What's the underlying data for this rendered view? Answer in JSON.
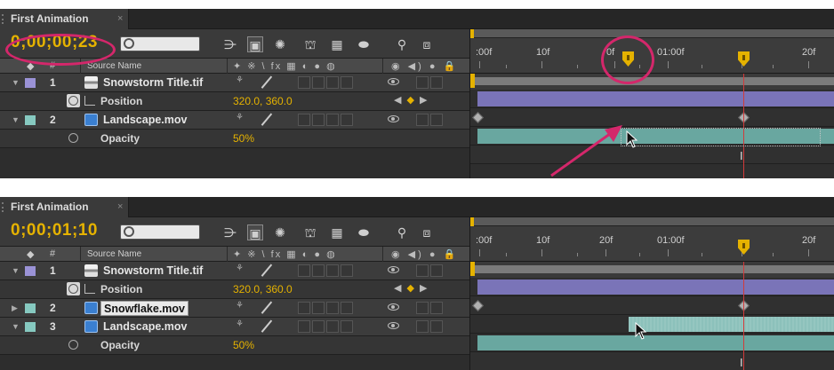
{
  "colors": {
    "timecode": "#e5b200",
    "label_purple": "#9a92d6",
    "label_teal": "#86c9c0",
    "layer_bar_purple": "#7a74b8",
    "layer_bar_teal": "#69a7a0",
    "cti": "#d23a3a",
    "annotation": "#d4276b"
  },
  "panels": [
    {
      "tab_title": "First Animation",
      "tab_close": "×",
      "timecode": "0;00;00;23",
      "columns": {
        "label_icon": "◆",
        "number_header": "#",
        "source_name_header": "Source Name",
        "switches_header": "✦ ※ \\ fx ▦ ◐ ● ◍",
        "av_header": "◉ ◀) ● 🔒"
      },
      "layers": [
        {
          "number": "1",
          "name": "Snowstorm Title.tif",
          "type": "tif",
          "label_color": "#9a92d6"
        },
        {
          "number": "2",
          "name": "Landscape.mov",
          "type": "mov",
          "label_color": "#86c9c0"
        }
      ],
      "properties": [
        {
          "name": "Position",
          "value": "320.0, 360.0"
        },
        {
          "name": "Opacity",
          "value": "50%"
        }
      ],
      "ruler_labels": [
        ":00f",
        "10f",
        "0f",
        "01:00f",
        "20f"
      ]
    },
    {
      "tab_title": "First Animation",
      "tab_close": "×",
      "timecode": "0;00;01;10",
      "columns": {
        "label_icon": "◆",
        "number_header": "#",
        "source_name_header": "Source Name",
        "switches_header": "✦ ※ \\ fx ▦ ◐ ● ◍",
        "av_header": "◉ ◀) ● 🔒"
      },
      "layers": [
        {
          "number": "1",
          "name": "Snowstorm Title.tif",
          "type": "tif",
          "label_color": "#9a92d6"
        },
        {
          "number": "2",
          "name": "Snowflake.mov",
          "type": "mov",
          "label_color": "#86c9c0"
        },
        {
          "number": "3",
          "name": "Landscape.mov",
          "type": "mov",
          "label_color": "#86c9c0"
        }
      ],
      "properties": [
        {
          "name": "Position",
          "value": "320.0, 360.0"
        },
        {
          "name": "Opacity",
          "value": "50%"
        }
      ],
      "ruler_labels": [
        ":00f",
        "10f",
        "20f",
        "01:00f",
        "20f"
      ]
    }
  ],
  "toolbar_icons": [
    "comp-mini-flowchart-icon",
    "draft-3d-icon",
    "shy-layers-icon",
    "frame-blending-icon",
    "motion-blur-icon",
    "brainstorm-icon",
    "graph-editor-icon"
  ],
  "keyframe_navigator": {
    "prev": "◀",
    "add": "◆",
    "next": "▶"
  },
  "opacity_marker_glyph": "I"
}
